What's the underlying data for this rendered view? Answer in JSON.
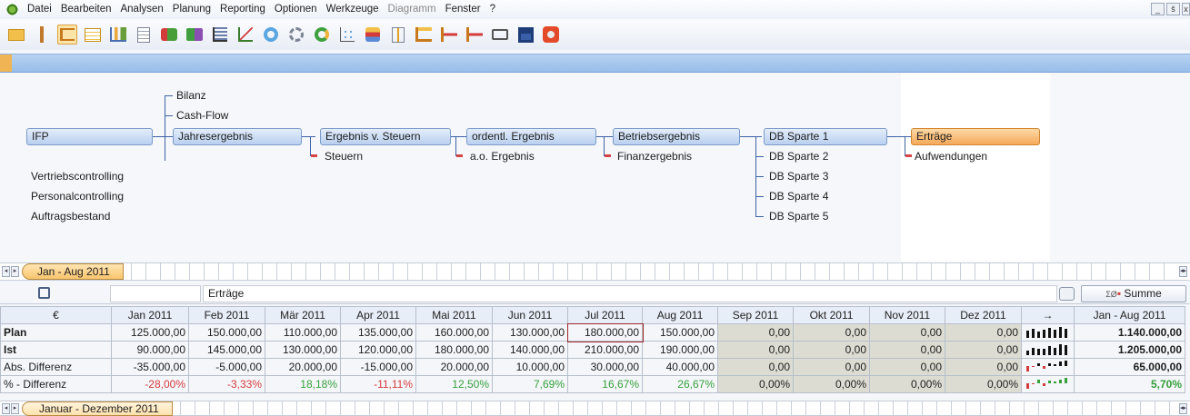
{
  "menu": {
    "items": [
      {
        "label": "Datei",
        "enabled": true
      },
      {
        "label": "Bearbeiten",
        "enabled": true
      },
      {
        "label": "Analysen",
        "enabled": true
      },
      {
        "label": "Planung",
        "enabled": true
      },
      {
        "label": "Reporting",
        "enabled": true
      },
      {
        "label": "Optionen",
        "enabled": true
      },
      {
        "label": "Werkzeuge",
        "enabled": true
      },
      {
        "label": "Diagramm",
        "enabled": false
      },
      {
        "label": "Fenster",
        "enabled": true
      },
      {
        "label": "?",
        "enabled": true
      }
    ],
    "minimize": "_",
    "restore": "š",
    "close": "x"
  },
  "toolbar": {
    "icons": [
      "open-folder-icon",
      "pin-icon",
      "tree-view-icon",
      "table-icon",
      "chart-analysis-icon",
      "document-icon",
      "cost-icon",
      "percent-icon",
      "bar-chart-icon",
      "line-chart-icon",
      "ring-chart-icon",
      "gear-chart-icon",
      "palette-icon",
      "scatter-icon",
      "database-icon",
      "info-icon",
      "tree-structure-icon",
      "export-icon",
      "import-icon",
      "print-icon",
      "save-icon",
      "power-icon"
    ]
  },
  "tree": {
    "root": "IFP",
    "root_children": [
      "Vertriebscontrolling",
      "Personalcontrolling",
      "Auftragsbestand"
    ],
    "bilanz": "Bilanz",
    "cashflow": "Cash-Flow",
    "jahresergebnis": "Jahresergebnis",
    "ergebnis_v_steuern": "Ergebnis v. Steuern",
    "steuern": "Steuern",
    "ordentl_ergebnis": "ordentl. Ergebnis",
    "ao_ergebnis": "a.o. Ergebnis",
    "betriebsergebnis": "Betriebsergebnis",
    "finanzergebnis": "Finanzergebnis",
    "db_sparte_1": "DB Sparte 1",
    "db_sparten": [
      "DB Sparte 2",
      "DB Sparte 3",
      "DB Sparte 4",
      "DB Sparte 5"
    ],
    "ertraege": "Erträge",
    "aufwendungen": "Aufwendungen"
  },
  "period_tab_top": "Jan - Aug 2011",
  "period_tab_bottom": "Januar - Dezember 2011",
  "grid": {
    "title": "Erträge",
    "summe_label": "Summe",
    "currency": "€",
    "months": [
      "Jan 2011",
      "Feb 2011",
      "Mär 2011",
      "Apr 2011",
      "Mai 2011",
      "Jun 2011",
      "Jul 2011",
      "Aug 2011",
      "Sep 2011",
      "Okt 2011",
      "Nov 2011",
      "Dez 2011"
    ],
    "arrow": "→",
    "total_header": "Jan - Aug 2011",
    "rows": [
      {
        "label": "Plan",
        "values": [
          "125.000,00",
          "150.000,00",
          "110.000,00",
          "135.000,00",
          "160.000,00",
          "130.000,00",
          "180.000,00",
          "150.000,00",
          "0,00",
          "0,00",
          "0,00",
          "0,00"
        ],
        "total": "1.140.000,00"
      },
      {
        "label": "Ist",
        "values": [
          "90.000,00",
          "145.000,00",
          "130.000,00",
          "120.000,00",
          "180.000,00",
          "140.000,00",
          "210.000,00",
          "190.000,00",
          "0,00",
          "0,00",
          "0,00",
          "0,00"
        ],
        "total": "1.205.000,00"
      },
      {
        "label": "Abs. Differenz",
        "values": [
          "-35.000,00",
          "-5.000,00",
          "20.000,00",
          "-15.000,00",
          "20.000,00",
          "10.000,00",
          "30.000,00",
          "40.000,00",
          "0,00",
          "0,00",
          "0,00",
          "0,00"
        ],
        "total": "65.000,00"
      },
      {
        "label": "% - Differenz",
        "values": [
          "-28,00%",
          "-3,33%",
          "18,18%",
          "-11,11%",
          "12,50%",
          "7,69%",
          "16,67%",
          "26,67%",
          "0,00%",
          "0,00%",
          "0,00%",
          "0,00%"
        ],
        "total": "5,70%"
      }
    ]
  },
  "colors": {
    "accent": "#f5a95a",
    "negative": "#d43c3c",
    "positive": "#36a03a",
    "node": "#b9d0ef"
  }
}
